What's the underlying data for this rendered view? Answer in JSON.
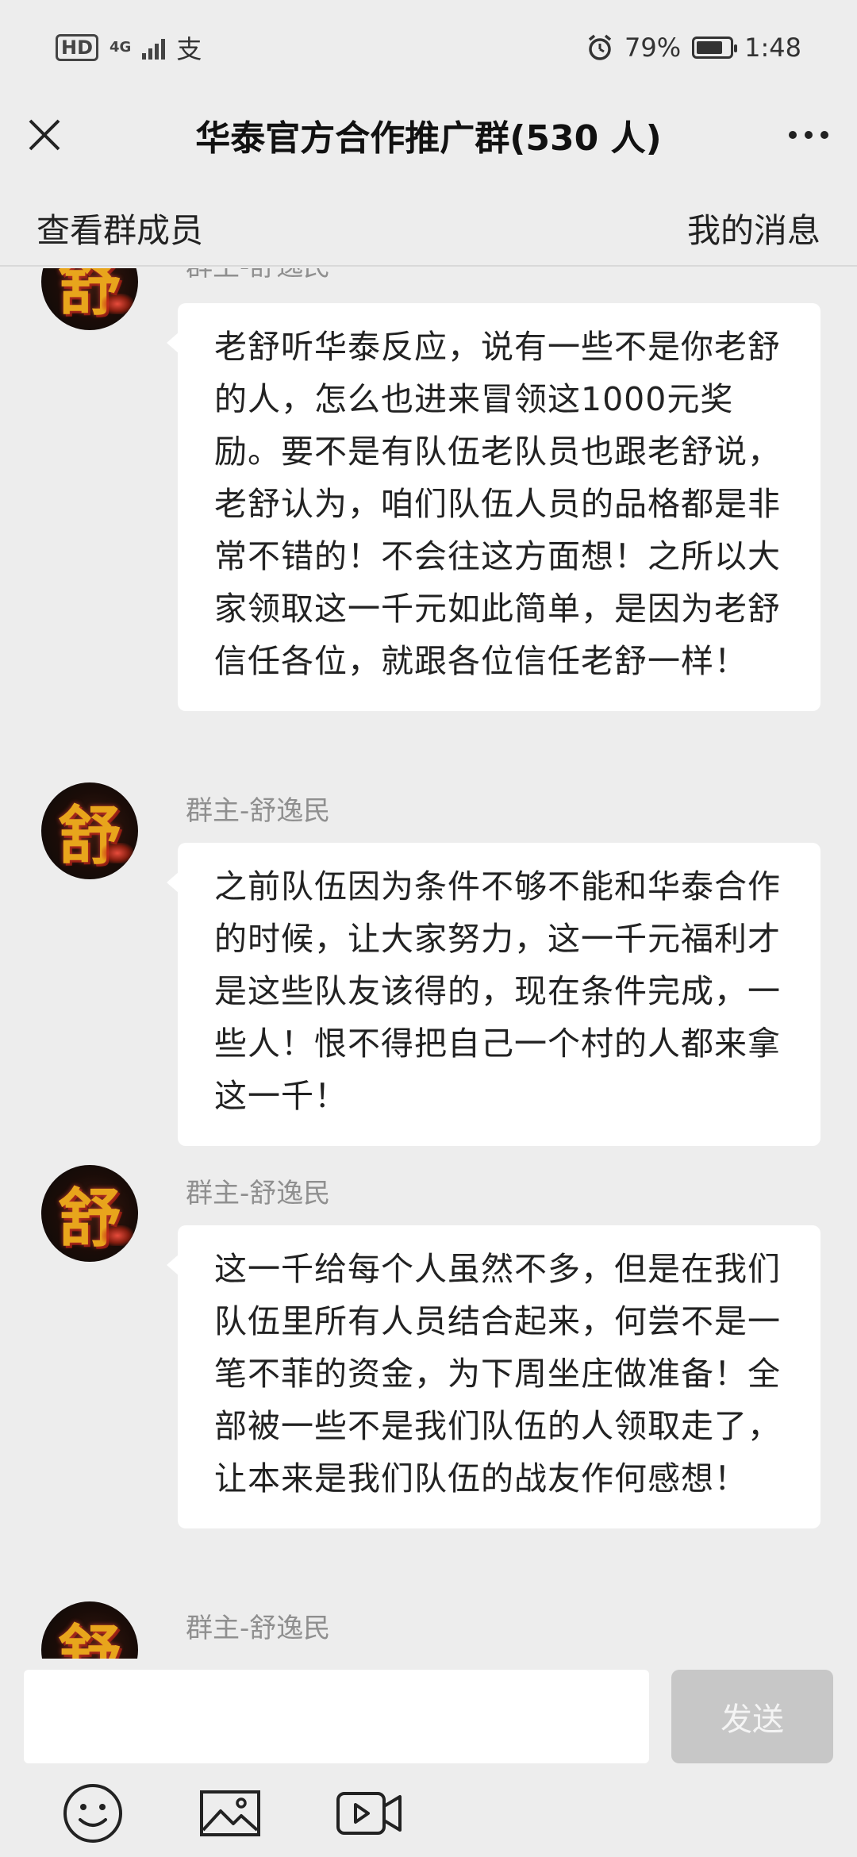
{
  "status_bar": {
    "hd": "HD",
    "network": "4G",
    "im_glyph": "支",
    "battery_percent": "79%",
    "battery_level": 0.79,
    "time": "1:48"
  },
  "header": {
    "title": "华泰官方合作推广群(530 人)"
  },
  "subbar": {
    "left_link": "查看群成员",
    "right_link": "我的消息"
  },
  "messages": [
    {
      "sender": "群主-舒逸民",
      "avatar_char": "舒",
      "text": "老舒听华泰反应，说有一些不是你老舒的人，怎么也进来冒领这1000元奖励。要不是有队伍老队员也跟老舒说，老舒认为，咱们队伍人员的品格都是非常不错的！不会往这方面想！之所以大家领取这一千元如此简单，是因为老舒信任各位，就跟各位信任老舒一样！"
    },
    {
      "sender": "群主-舒逸民",
      "avatar_char": "舒",
      "text": "之前队伍因为条件不够不能和华泰合作的时候，让大家努力，这一千元福利才是这些队友该得的，现在条件完成，一些人！恨不得把自己一个村的人都来拿这一千！"
    },
    {
      "sender": "群主-舒逸民",
      "avatar_char": "舒",
      "text": "这一千给每个人虽然不多，但是在我们队伍里所有人员结合起来，何尝不是一笔不菲的资金，为下周坐庄做准备！全部被一些不是我们队伍的人领取走了，让本来是我们队伍的战友作何感想！"
    },
    {
      "sender": "群主-舒逸民",
      "avatar_char": "舒",
      "text": ""
    }
  ],
  "input_bar": {
    "placeholder": "",
    "send_label": "发送",
    "tools": [
      "emoji-icon",
      "image-icon",
      "video-icon"
    ]
  }
}
